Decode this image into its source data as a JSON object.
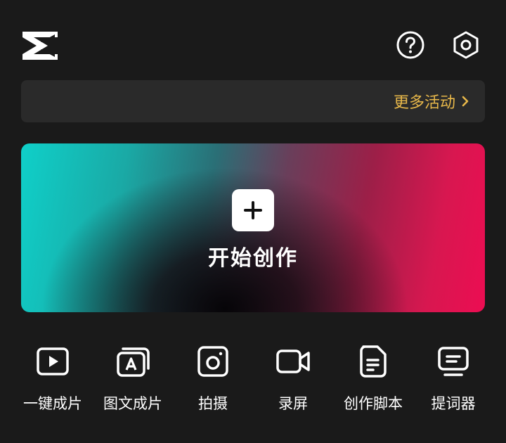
{
  "header": {
    "logo_icon": "capcut-logo-icon",
    "help_icon": "help-circle-icon",
    "settings_icon": "settings-hexagon-icon"
  },
  "banner": {
    "link_label": "更多活动",
    "link_icon": "chevron-right-icon",
    "link_color": "#e8b84a"
  },
  "create": {
    "label": "开始创作",
    "icon": "plus-icon",
    "gradient_colors": [
      "#0fd0c9",
      "#050306",
      "#ec0d52"
    ]
  },
  "tools": [
    {
      "label": "一键成片",
      "icon": "play-video-icon"
    },
    {
      "label": "图文成片",
      "icon": "text-to-video-icon"
    },
    {
      "label": "拍摄",
      "icon": "camera-icon"
    },
    {
      "label": "录屏",
      "icon": "screen-record-icon"
    },
    {
      "label": "创作脚本",
      "icon": "script-document-icon"
    },
    {
      "label": "提词器",
      "icon": "teleprompter-icon"
    }
  ]
}
